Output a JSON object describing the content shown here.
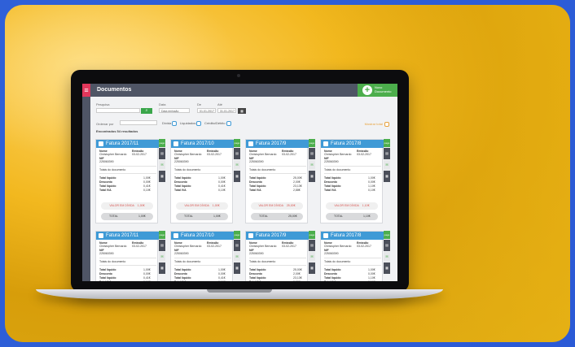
{
  "app": {
    "title": "Documentos",
    "new_document_label": "Novo Documento"
  },
  "filters": {
    "search_label": "Pesquisa",
    "date_label": "Data",
    "date_value": "Data emissão",
    "from_label": "De",
    "from_value": "01-01-2017",
    "to_label": "Até",
    "to_value": "31-01-2017",
    "order_label": "Ordenar por",
    "chk_divida": "Dívida",
    "chk_liquidados": "Liquidados",
    "chk_credito": "Crédito/Débito",
    "show_total": "Mostrar total"
  },
  "results_text": "Encontrados 54 resultados",
  "cards": [
    {
      "title": "Fatura 2017/11",
      "nome": "Christopher Bernardo",
      "emissao": "03-02-2017",
      "nif": "225060390"
    },
    {
      "title": "Fatura 2017/10",
      "nome": "Christopher Bernardo",
      "emissao": "03-02-2017",
      "nif": "225060390"
    },
    {
      "title": "Fatura 2017/9",
      "nome": "Christopher Bernardo",
      "emissao": "03-02-2017",
      "nif": "225060390"
    },
    {
      "title": "Fatura 2017/8",
      "nome": "Christopher Bernardo",
      "emissao": "03-02-2017",
      "nif": "225060390"
    },
    {
      "title": "Fatura 2017/11",
      "nome": "Christopher Bernardo",
      "emissao": "03-02-2017",
      "nif": "225060390"
    },
    {
      "title": "Fatura 2017/10",
      "nome": "Christopher Bernardo",
      "emissao": "03-02-2017",
      "nif": "225060390"
    },
    {
      "title": "Fatura 2017/9",
      "nome": "Christopher Bernardo",
      "emissao": "03-02-2017",
      "nif": "225060390"
    },
    {
      "title": "Fatura 2017/8",
      "nome": "Christopher Bernardo",
      "emissao": "03-02-2017",
      "nif": "225060390"
    }
  ],
  "card_labels": {
    "nome": "Nome",
    "emissao": "Emissão",
    "nif": "NIF",
    "totais": "Totais do documento",
    "total_liquido": "Total líquido",
    "desconto": "Desconto",
    "total_iva": "Total IVA",
    "valor_divida": "VALOR EM DÍVIDA",
    "total": "TOTAL",
    "pago": "pago"
  },
  "card_values": [
    {
      "liquido": "1,00€",
      "desconto": "0,00€",
      "iva": "0,41€",
      "iva2": "0,10€",
      "divida": "1,00€",
      "total": "1,00€"
    },
    {
      "liquido": "1,00€",
      "desconto": "0,00€",
      "iva": "0,41€",
      "iva2": "0,10€",
      "divida": "1,00€",
      "total": "1,00€"
    },
    {
      "liquido": "25,00€",
      "desconto": "2,00€",
      "iva": "23,13€",
      "iva2": "2,88€",
      "divida": "25,00€",
      "total": "25,00€"
    },
    {
      "liquido": "1,00€",
      "desconto": "0,00€",
      "iva": "1,10€",
      "iva2": "0,10€",
      "divida": "1,10€",
      "total": "1,10€"
    }
  ]
}
